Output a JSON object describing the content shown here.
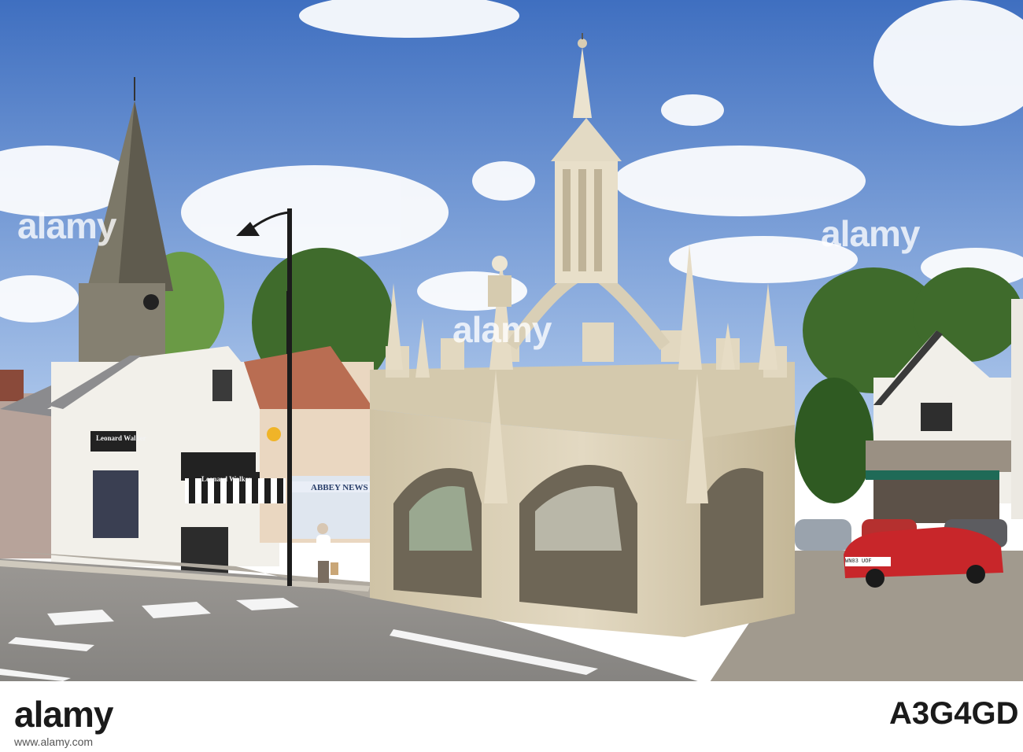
{
  "photo": {
    "scene": "Market cross with town square"
  },
  "watermark": {
    "main": "alamy",
    "left": "alamy",
    "right": "alamy"
  },
  "signs": {
    "abbey_news": "ABBEY NEWS",
    "leonard_walker_1": "Leonard Walker",
    "leonard_walker_2": "Leonard Walker"
  },
  "car_plate": "WN03 UOF",
  "footer": {
    "brand": "alamy",
    "image_id": "A3G4GD",
    "url": "www.alamy.com"
  },
  "colors": {
    "sky_top": "#4a78c4",
    "sky_bottom": "#a9c5ea",
    "stone": "#d8cdb3",
    "road": "#8e8c88",
    "red_car": "#c8262a"
  }
}
